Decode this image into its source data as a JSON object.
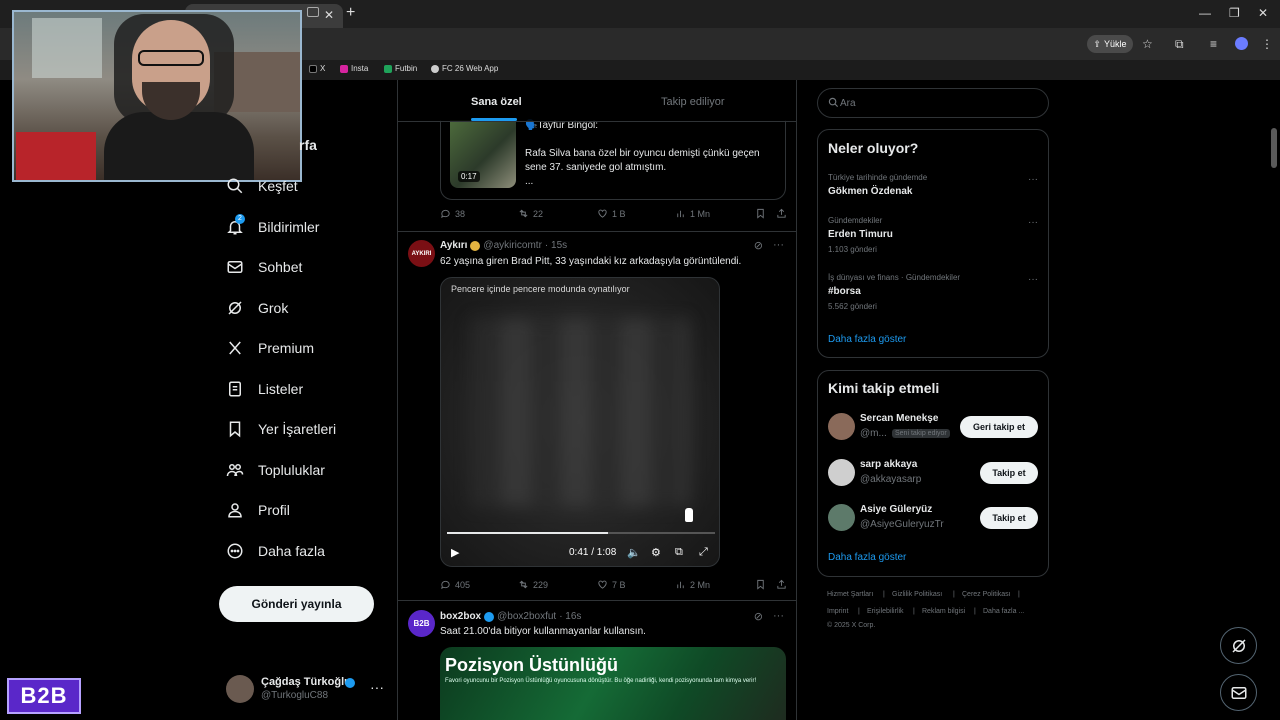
{
  "browser": {
    "new_tab": "+",
    "window_min": "—",
    "window_max": "❐",
    "window_close": "✕",
    "upload_label": "Yükle",
    "bookmarks": [
      {
        "label": "X",
        "color": "#000000"
      },
      {
        "label": "Insta",
        "color": "#d6249f"
      },
      {
        "label": "Futbin",
        "color": "#1fa35a"
      },
      {
        "label": "FC 26 Web App",
        "color": "#cccccc"
      }
    ]
  },
  "nav": {
    "profile_partial": "rfa",
    "items": [
      {
        "label": "Keşfet",
        "icon": "search-icon"
      },
      {
        "label": "Bildirimler",
        "icon": "bell-icon",
        "badge": "2"
      },
      {
        "label": "Sohbet",
        "icon": "mail-icon"
      },
      {
        "label": "Grok",
        "icon": "grok-icon"
      },
      {
        "label": "Premium",
        "icon": "x-logo-icon"
      },
      {
        "label": "Listeler",
        "icon": "list-icon"
      },
      {
        "label": "Yer İşaretleri",
        "icon": "bookmark-icon"
      },
      {
        "label": "Topluluklar",
        "icon": "communities-icon"
      },
      {
        "label": "Profil",
        "icon": "person-icon"
      },
      {
        "label": "Daha fazla",
        "icon": "more-circle-icon"
      }
    ],
    "post_button": "Gönderi yayınla",
    "account": {
      "name": "Çağdaş Türkoğlu",
      "handle": "@TurkogluC88",
      "more": "···"
    }
  },
  "b2b_logo": "B2B",
  "timeline": {
    "tabs": [
      "Sana özel",
      "Takip ediliyor"
    ],
    "quoted": {
      "author": "🗣️Tayfur Bingöl:",
      "duration": "0:17",
      "text": "Rafa Silva bana özel bir oyuncu demişti çünkü geçen sene 37. saniyede gol atmıştım.",
      "ellipsis": "..."
    },
    "posts": [
      {
        "actions": {
          "reply": "38",
          "repost": "22",
          "like": "1 B",
          "views": "1 Mn"
        }
      },
      {
        "name": "Aykırı",
        "handle": "@aykiricomtr",
        "time": "· 15s",
        "verified_color": "#e3b341",
        "avatar_label": "AYKIRI",
        "text": "62 yaşına giren Brad Pitt, 33 yaşındaki kız arkadaşıyla görüntülendi.",
        "video": {
          "pip_label": "Pencere içinde pencere modunda oynatılıyor",
          "time": "0:41 / 1:08",
          "progress": 0.6
        },
        "actions": {
          "reply": "405",
          "repost": "229",
          "like": "7 B",
          "views": "2 Mn"
        }
      },
      {
        "name": "box2box",
        "handle": "@box2boxfut",
        "time": "· 16s",
        "verified_color": "#1d9bf0",
        "avatar_label": "B2B",
        "text": "Saat 21.00'da bitiyor kullanmayanlar kullansın.",
        "promo_title": "Pozisyon Üstünlüğü",
        "promo_sub": "Favori oyuncunu bir Pozisyon Üstünlüğü oyuncusuna dönüştür. Bu öğe nadirliği, kendi pozisyonunda tam kimya verir!"
      }
    ]
  },
  "sidebar": {
    "search_placeholder": "Ara",
    "trends_title": "Neler oluyor?",
    "trends": [
      {
        "category": "Türkiye tarihinde gündemde",
        "name": "Gökmen Özdenak",
        "count": ""
      },
      {
        "category": "Gündemdekiler",
        "name": "Erden Timuru",
        "count": "1.103 gönderi"
      },
      {
        "category": "İş dünyası ve finans · Gündemdekiler",
        "name": "#borsa",
        "count": "5.562 gönderi"
      }
    ],
    "trends_more": "Daha fazla göster",
    "follow_title": "Kimi takip etmeli",
    "follow": [
      {
        "name": "Sercan Menekşe",
        "handle": "@m...",
        "follows_you": "Seni takip ediyor",
        "button": "Geri takip et"
      },
      {
        "name": "sarp akkaya",
        "handle": "@akkayasarp",
        "follows_you": "",
        "button": "Takip et"
      },
      {
        "name": "Asiye Güleryüz",
        "handle": "@AsiyeGuleryuzTr",
        "follows_you": "",
        "button": "Takip et"
      }
    ],
    "follow_more": "Daha fazla göster",
    "footer": [
      "Hizmet Şartları",
      "|",
      "Gizlilik Politikası",
      "|",
      "Çerez Politikası",
      "|",
      "Imprint",
      "|",
      "Erişilebilirlik",
      "|",
      "Reklam bilgisi",
      "|",
      "Daha fazla ...",
      "© 2025 X Corp."
    ]
  }
}
